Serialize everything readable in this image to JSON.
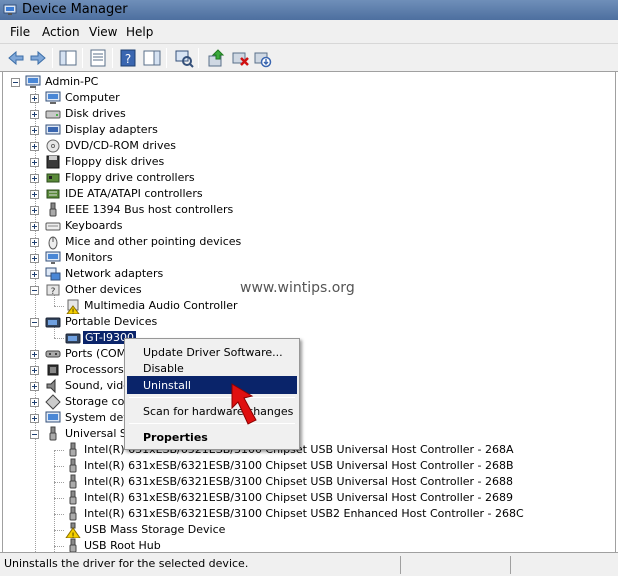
{
  "window": {
    "title": "Device Manager"
  },
  "menu": [
    "File",
    "Action",
    "View",
    "Help"
  ],
  "toolbar": {
    "icons": [
      "back-arrow-icon",
      "forward-arrow-icon",
      "show-hide-console-tree-icon",
      "properties-icon",
      "help-icon",
      "action-pane-icon",
      "scan-hardware-icon",
      "update-driver-icon",
      "uninstall-device-icon",
      "disable-device-icon"
    ]
  },
  "tree": {
    "root": "Admin-PC",
    "categories": [
      {
        "label": "Computer",
        "icon": "computer-icon"
      },
      {
        "label": "Disk drives",
        "icon": "disk-drive-icon"
      },
      {
        "label": "Display adapters",
        "icon": "display-adapter-icon"
      },
      {
        "label": "DVD/CD-ROM drives",
        "icon": "dvd-drive-icon"
      },
      {
        "label": "Floppy disk drives",
        "icon": "floppy-disk-icon"
      },
      {
        "label": "Floppy drive controllers",
        "icon": "floppy-controller-icon"
      },
      {
        "label": "IDE ATA/ATAPI controllers",
        "icon": "ide-controller-icon"
      },
      {
        "label": "IEEE 1394 Bus host controllers",
        "icon": "ieee1394-icon"
      },
      {
        "label": "Keyboards",
        "icon": "keyboard-icon"
      },
      {
        "label": "Mice and other pointing devices",
        "icon": "mouse-icon"
      },
      {
        "label": "Monitors",
        "icon": "monitor-icon"
      },
      {
        "label": "Network adapters",
        "icon": "network-adapter-icon"
      }
    ],
    "other_devices": {
      "label": "Other devices",
      "child": "Multimedia Audio Controller"
    },
    "portable_devices": {
      "label": "Portable Devices",
      "child": "GT-I9300"
    },
    "after": [
      {
        "label": "Ports (COM & LPT)",
        "visible": "Ports (COM &",
        "icon": "port-icon"
      },
      {
        "label": "Processors",
        "icon": "processor-icon"
      },
      {
        "label": "Sound, video and game controllers",
        "visible": "Sound, video",
        "icon": "sound-icon"
      },
      {
        "label": "Storage controllers",
        "visible": "Storage cont",
        "icon": "storage-controller-icon"
      },
      {
        "label": "System devices",
        "visible": "System devic",
        "icon": "system-device-icon"
      }
    ],
    "usb": {
      "label": "Universal Serial Bus controllers",
      "visible": "Universal Se",
      "children": [
        "Intel(R) 631xESB/6321ESB/3100 Chipset USB Universal Host Controller - 268A",
        "Intel(R) 631xESB/6321ESB/3100 Chipset USB Universal Host Controller - 268B",
        "Intel(R) 631xESB/6321ESB/3100 Chipset USB Universal Host Controller - 2688",
        "Intel(R) 631xESB/6321ESB/3100 Chipset USB Universal Host Controller - 2689",
        "Intel(R) 631xESB/6321ESB/3100 Chipset USB2 Enhanced Host Controller - 268C",
        "USB Mass Storage Device",
        "USB Root Hub"
      ]
    }
  },
  "context_menu": {
    "items": [
      "Update Driver Software...",
      "Disable",
      "Uninstall",
      "Scan for hardware changes",
      "Properties"
    ],
    "highlighted": "Uninstall"
  },
  "watermark": "www.wintips.org",
  "status": "Uninstalls the driver for the selected device.",
  "colors": {
    "selection": "#0a246a",
    "arrow": "#e01010"
  }
}
